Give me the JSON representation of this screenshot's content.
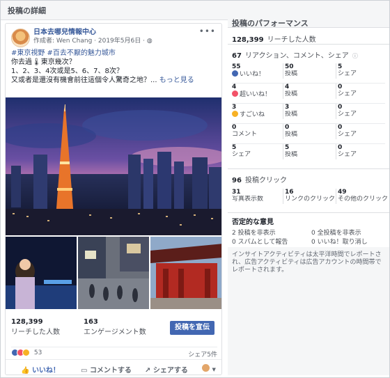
{
  "dialog": {
    "title": "投稿の詳細"
  },
  "post": {
    "page_name": "日本去哪兒情報中心",
    "author_line": "作成者: Wen Chang · 2019年5月6日 ·",
    "tags": "#東京視野 #百去不厭的魅力城市",
    "text_line1": "你去過🌡東京幾次？",
    "text_line2": "1、2、3、4次或是5、6、7、8次？",
    "text_line3": "又或者是還沒有機會前往這個令人驚奇之地？...",
    "more_link": "もっと見る",
    "reach_num": "128,399",
    "reach_label": "リーチした人数",
    "engage_num": "163",
    "engage_label": "エンゲージメント数",
    "boost_label": "投稿を宣伝",
    "reaction_count": "53",
    "shares_label": "シェア5件",
    "like_label": "いいね！",
    "comment_label": "コメントする",
    "share_label": "シェアする"
  },
  "performance": {
    "title": "投稿のパフォーマンス",
    "reach_num": "128,399",
    "reach_label": "リーチした人数",
    "engage_num": "67",
    "engage_label": "リアクション、コメント、シェア",
    "reactions": [
      {
        "cells": [
          {
            "n": "55",
            "l": "いいね！"
          },
          {
            "n": "50",
            "l": "投稿"
          },
          {
            "n": "5",
            "l": "シェア"
          }
        ]
      },
      {
        "cells": [
          {
            "n": "4",
            "l": "超いいね！"
          },
          {
            "n": "4",
            "l": "投稿"
          },
          {
            "n": "0",
            "l": "シェア"
          }
        ]
      },
      {
        "cells": [
          {
            "n": "3",
            "l": "すごいね"
          },
          {
            "n": "3",
            "l": "投稿"
          },
          {
            "n": "0",
            "l": "シェア"
          }
        ]
      },
      {
        "cells": [
          {
            "n": "0",
            "l": "コメント"
          },
          {
            "n": "0",
            "l": "投稿"
          },
          {
            "n": "0",
            "l": "シェア"
          }
        ]
      },
      {
        "cells": [
          {
            "n": "5",
            "l": "シェア"
          },
          {
            "n": "5",
            "l": "投稿"
          },
          {
            "n": "0",
            "l": "シェア"
          }
        ]
      }
    ],
    "clicks_num": "96",
    "clicks_label": "投稿クリック",
    "clicks": [
      {
        "n": "31",
        "l": "写真表示数"
      },
      {
        "n": "16",
        "l": "リンクのクリック"
      },
      {
        "n": "49",
        "l": "その他のクリック"
      }
    ],
    "negative_title": "否定的な意見",
    "negative": [
      "2 投稿を非表示",
      "0 全投稿を非表示",
      "0 スパムとして報告",
      "0 いいね！取り消し"
    ],
    "note": "インサイトアクティビティは太平洋時間でレポートされ、広告アクティビティは広告アカウントの時間帯でレポートされます。"
  },
  "colors": {
    "accent": "#4267b2",
    "link": "#365899"
  }
}
